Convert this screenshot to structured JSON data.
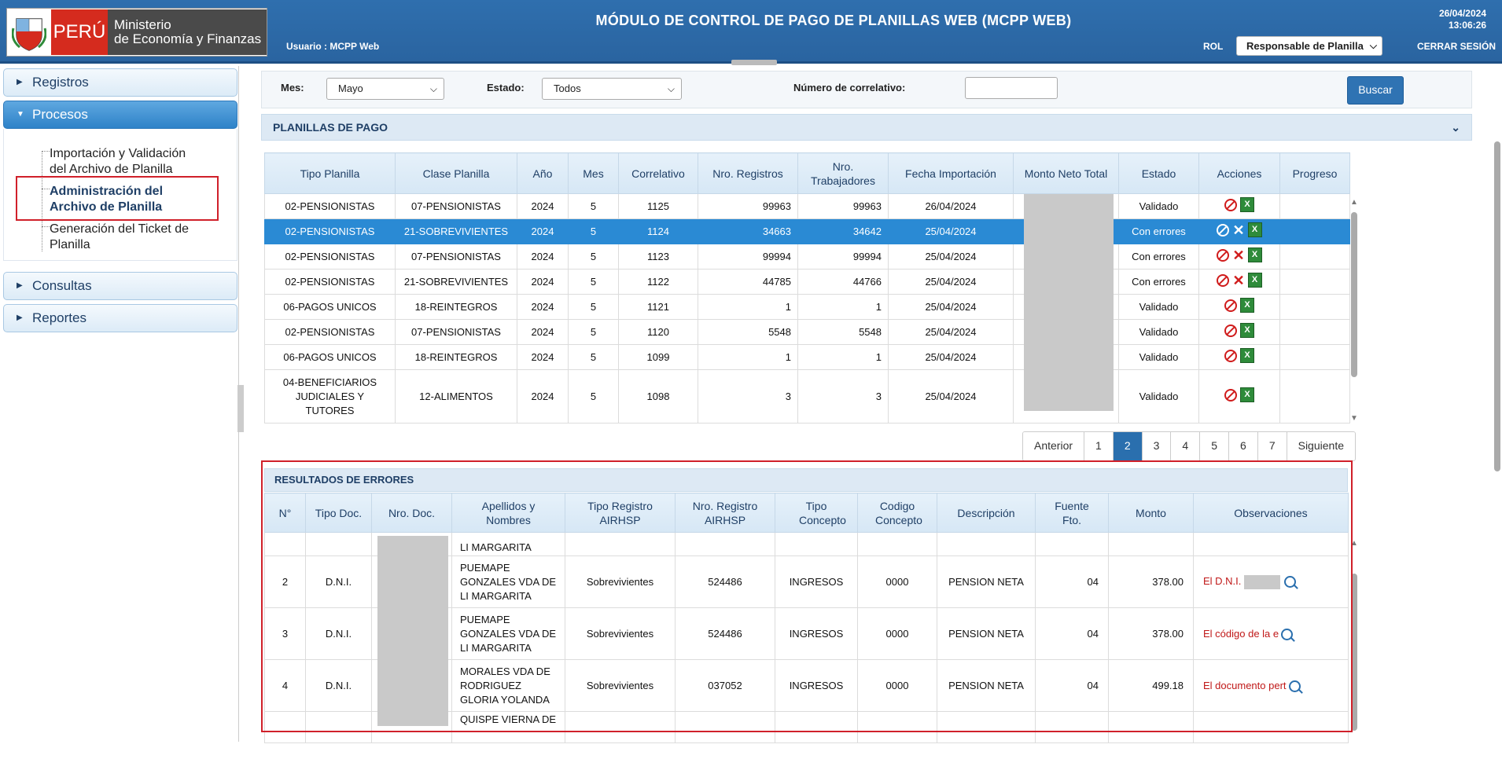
{
  "header": {
    "logo_country": "PERÚ",
    "logo_ministry_line1": "Ministerio",
    "logo_ministry_line2": "de Economía y Finanzas",
    "title": "MÓDULO DE CONTROL DE PAGO DE PLANILLAS WEB (MCPP WEB)",
    "user": "Usuario : MCPP Web",
    "date": "26/04/2024",
    "time": "13:06:26",
    "rol_label": "ROL",
    "rol_value": "Responsable de Planilla",
    "logout": "CERRAR SESIÓN",
    "colors": {
      "bar": "#2f6fae",
      "peru_red": "#d52b1e"
    }
  },
  "sidebar": {
    "sections": [
      {
        "label": "Registros",
        "expanded": false
      },
      {
        "label": "Procesos",
        "expanded": true
      },
      {
        "label": "Consultas",
        "expanded": false
      },
      {
        "label": "Reportes",
        "expanded": false
      }
    ],
    "procesos_items": [
      {
        "line1": "Importación y Validación",
        "line2": "del Archivo de Planilla",
        "active": false
      },
      {
        "line1": "Administración del",
        "line2": "Archivo de Planilla",
        "active": true
      },
      {
        "line1": "Generación del Ticket de",
        "line2": "Planilla",
        "active": false
      }
    ]
  },
  "filters": {
    "mes_label": "Mes:",
    "mes_value": "Mayo",
    "estado_label": "Estado:",
    "estado_value": "Todos",
    "correlativo_label": "Número de correlativo:",
    "correlativo_value": "",
    "search_button": "Buscar"
  },
  "planillas": {
    "title": "PLANILLAS DE PAGO",
    "columns": [
      "Tipo Planilla",
      "Clase Planilla",
      "Año",
      "Mes",
      "Correlativo",
      "Nro. Registros",
      "Nro. Trabajadores",
      "Fecha Importación",
      "Monto Neto Total",
      "Estado",
      "Acciones",
      "Progreso"
    ],
    "rows": [
      {
        "tipo": "02-PENSIONISTAS",
        "clase": "07-PENSIONISTAS",
        "anio": "2024",
        "mes": "5",
        "corr": "1125",
        "reg": "99963",
        "trab": "99963",
        "fecha": "26/04/2024",
        "estado": "Validado",
        "errors": false
      },
      {
        "tipo": "02-PENSIONISTAS",
        "clase": "21-SOBREVIVIENTES",
        "anio": "2024",
        "mes": "5",
        "corr": "1124",
        "reg": "34663",
        "trab": "34642",
        "fecha": "25/04/2024",
        "estado": "Con errores",
        "errors": true
      },
      {
        "tipo": "02-PENSIONISTAS",
        "clase": "07-PENSIONISTAS",
        "anio": "2024",
        "mes": "5",
        "corr": "1123",
        "reg": "99994",
        "trab": "99994",
        "fecha": "25/04/2024",
        "estado": "Con errores",
        "errors": true
      },
      {
        "tipo": "02-PENSIONISTAS",
        "clase": "21-SOBREVIVIENTES",
        "anio": "2024",
        "mes": "5",
        "corr": "1122",
        "reg": "44785",
        "trab": "44766",
        "fecha": "25/04/2024",
        "estado": "Con errores",
        "errors": true
      },
      {
        "tipo": "06-PAGOS UNICOS",
        "clase": "18-REINTEGROS",
        "anio": "2024",
        "mes": "5",
        "corr": "1121",
        "reg": "1",
        "trab": "1",
        "fecha": "25/04/2024",
        "estado": "Validado",
        "errors": false
      },
      {
        "tipo": "02-PENSIONISTAS",
        "clase": "07-PENSIONISTAS",
        "anio": "2024",
        "mes": "5",
        "corr": "1120",
        "reg": "5548",
        "trab": "5548",
        "fecha": "25/04/2024",
        "estado": "Validado",
        "errors": false
      },
      {
        "tipo": "06-PAGOS UNICOS",
        "clase": "18-REINTEGROS",
        "anio": "2024",
        "mes": "5",
        "corr": "1099",
        "reg": "1",
        "trab": "1",
        "fecha": "25/04/2024",
        "estado": "Validado",
        "errors": false
      },
      {
        "tipo": "04-BENEFICIARIOS JUDICIALES Y TUTORES",
        "clase": "12-ALIMENTOS",
        "anio": "2024",
        "mes": "5",
        "corr": "1098",
        "reg": "3",
        "trab": "3",
        "fecha": "25/04/2024",
        "estado": "Validado",
        "errors": false
      }
    ],
    "pager": [
      "Anterior",
      "1",
      "2",
      "3",
      "4",
      "5",
      "6",
      "7",
      "Siguiente"
    ],
    "current_page": "2"
  },
  "errores": {
    "title": "RESULTADOS DE ERRORES",
    "columns": [
      "N°",
      "Tipo Doc.",
      "Nro. Doc.",
      "Apellidos y Nombres",
      "Tipo Registro AIRHSP",
      "Nro. Registro AIRHSP",
      "Tipo Concepto",
      "Codigo Concepto",
      "Descripción",
      "Fuente Fto.",
      "Monto",
      "Observaciones"
    ],
    "rows": [
      {
        "n": "",
        "tipo": "",
        "nombre": "LI MARGARITA",
        "treg": "",
        "nreg": "",
        "tcon": "",
        "ccon": "",
        "desc": "",
        "ff": "",
        "monto": "",
        "obs": ""
      },
      {
        "n": "2",
        "tipo": "D.N.I.",
        "nombre": "PUEMAPE GONZALES VDA DE LI MARGARITA",
        "treg": "Sobrevivientes",
        "nreg": "524486",
        "tcon": "INGRESOS",
        "ccon": "0000",
        "desc": "PENSION NETA",
        "ff": "04",
        "monto": "378.00",
        "obs": "El D.N.I."
      },
      {
        "n": "3",
        "tipo": "D.N.I.",
        "nombre": "PUEMAPE GONZALES VDA DE LI MARGARITA",
        "treg": "Sobrevivientes",
        "nreg": "524486",
        "tcon": "INGRESOS",
        "ccon": "0000",
        "desc": "PENSION NETA",
        "ff": "04",
        "monto": "378.00",
        "obs": "El código de la e"
      },
      {
        "n": "4",
        "tipo": "D.N.I.",
        "nombre": "MORALES VDA DE RODRIGUEZ GLORIA YOLANDA",
        "treg": "Sobrevivientes",
        "nreg": "037052",
        "tcon": "INGRESOS",
        "ccon": "0000",
        "desc": "PENSION NETA",
        "ff": "04",
        "monto": "499.18",
        "obs": "El documento pert"
      },
      {
        "n": "",
        "tipo": "",
        "nombre": "QUISPE VIERNA DE",
        "treg": "",
        "nreg": "",
        "tcon": "",
        "ccon": "",
        "desc": "",
        "ff": "",
        "monto": "",
        "obs": ""
      }
    ]
  }
}
